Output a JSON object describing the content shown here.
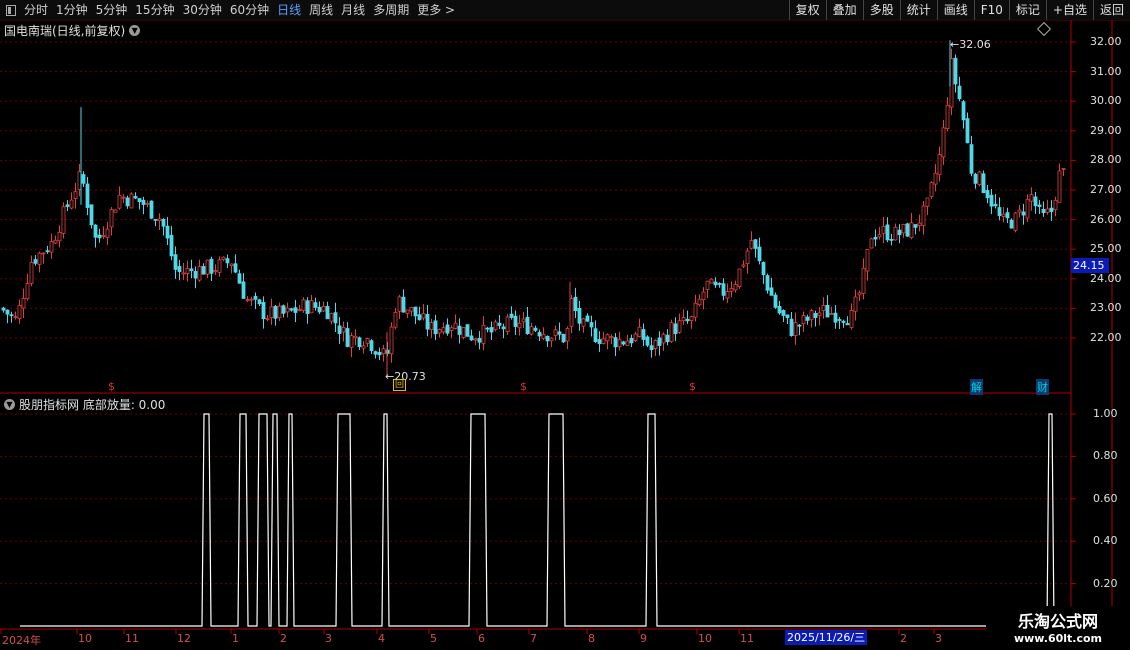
{
  "toolbar": {
    "periods": [
      "分时",
      "1分钟",
      "5分钟",
      "15分钟",
      "30分钟",
      "60分钟",
      "日线",
      "周线",
      "月线",
      "多周期",
      "更多 >"
    ],
    "active_index": 6,
    "buttons": [
      "复权",
      "叠加",
      "多股",
      "统计",
      "画线",
      "F10",
      "标记",
      "+自选",
      "返回"
    ]
  },
  "stock": {
    "title": "国电南瑞(日线,前复权)"
  },
  "indicator": {
    "title": "股朋指标网 底部放量: 0.00"
  },
  "price_axis": [
    "32.00",
    "31.00",
    "30.00",
    "29.00",
    "28.00",
    "27.00",
    "26.00",
    "25.00",
    "24.00",
    "23.00",
    "22.00"
  ],
  "indicator_axis": [
    "1.00",
    "0.80",
    "0.60",
    "0.40",
    "0.20"
  ],
  "current_price": "24.15",
  "annotations": {
    "high": "32.06",
    "low": "20.73"
  },
  "x_axis": {
    "labels": [
      "2024年",
      "10",
      "11",
      "12",
      "1",
      "2",
      "3",
      "4",
      "5",
      "6",
      "7",
      "8",
      "9",
      "10",
      "11",
      "2",
      "3"
    ],
    "cursor_date": "2025/11/26/三"
  },
  "markers": [
    {
      "text": "$",
      "color": "#e03030"
    },
    {
      "text": "回",
      "color": "#e0c000"
    },
    {
      "text": "$",
      "color": "#e03030"
    },
    {
      "text": "$",
      "color": "#e03030"
    },
    {
      "text": "解",
      "color": "#00d0e0"
    },
    {
      "text": "财",
      "color": "#00d0e0"
    }
  ],
  "watermark": {
    "line1": "乐淘公式网",
    "line2": "www.60lt.com"
  },
  "colors": {
    "up": "#e04040",
    "down": "#50d8e8",
    "grid": "#7a0000",
    "signal": "#ffffff"
  },
  "chart_data": {
    "type": "candlestick",
    "ylim": [
      20.5,
      32.5
    ],
    "high": 32.06,
    "low": 20.73,
    "last": 24.15,
    "indicator_ylim": [
      0,
      1
    ],
    "indicator_values": [
      0.0
    ]
  }
}
